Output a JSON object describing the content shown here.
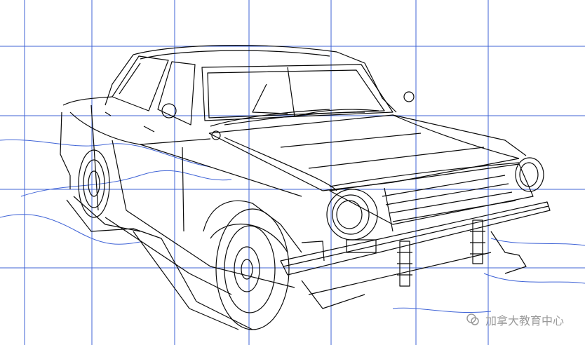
{
  "image": {
    "subject": "car-wireframe",
    "colors": {
      "background": "#ffffff",
      "grid": "#3f63d6",
      "lines": "#0a0a0a",
      "watermark": "#9a9a9a"
    }
  },
  "watermark": {
    "text": "加拿大教育中心",
    "icon": "wechat-icon"
  }
}
